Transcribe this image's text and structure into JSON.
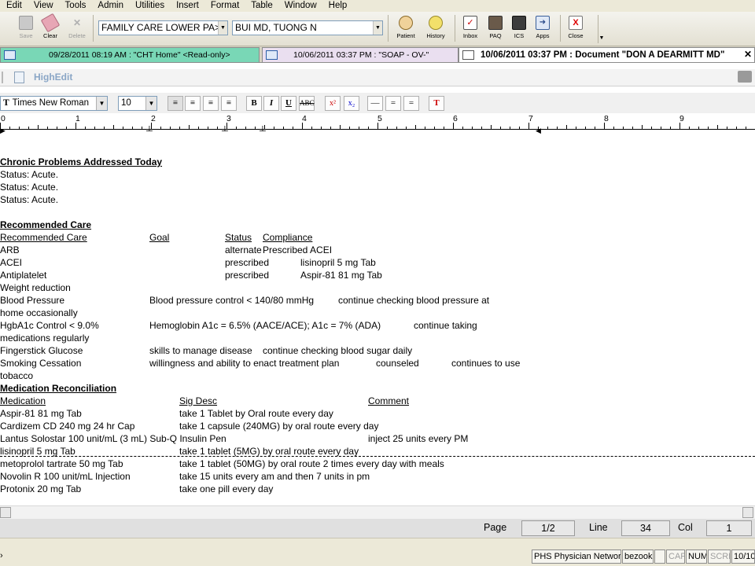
{
  "menu": [
    "Edit",
    "View",
    "Tools",
    "Admin",
    "Utilities",
    "Insert",
    "Format",
    "Table",
    "Window",
    "Help"
  ],
  "toolbar": {
    "save_label": "Save",
    "clear_label": "Clear",
    "delete_label": "Delete",
    "location_combo": "FAMILY CARE LOWER PA>",
    "provider_combo": "BUI MD, TUONG  N",
    "patient_label": "Patient",
    "history_label": "History",
    "inbox_label": "Inbox",
    "paq_label": "PAQ",
    "ics_label": "ICS",
    "apps_label": "Apps",
    "close_label": "Close"
  },
  "tabs": [
    {
      "label": "09/28/2011 08:19 AM : \"CHT Home\" <Read-only>"
    },
    {
      "label": "10/06/2011 03:37 PM : \"SOAP - OV-\""
    },
    {
      "label": "10/06/2011 03:37 PM  : Document \"DON A DEARMITT MD\""
    }
  ],
  "highedit": {
    "title": "HighEdit"
  },
  "format": {
    "font_name": "Times New Roman",
    "font_size": "10",
    "bold": "B",
    "italic": "I",
    "underline": "U",
    "strike": "ABC"
  },
  "ruler": {
    "numbers": [
      "0",
      "1",
      "2",
      "3",
      "4",
      "5",
      "6",
      "7",
      "8",
      "9"
    ]
  },
  "document": {
    "chronic_header": "Chronic Problems Addressed Today",
    "status_lines": [
      "Status: Acute.",
      "Status: Acute.",
      "Status: Acute."
    ],
    "rec_header": "Recommended Care",
    "rec_cols": {
      "care": "Recommended Care",
      "goal": "Goal",
      "status": "Status",
      "compliance": "Compliance"
    },
    "rec_rows": [
      {
        "care": "ARB",
        "goal": "",
        "status": "alternate",
        "compliance": "Prescribed ACEI"
      },
      {
        "care": "ACEI",
        "goal": "",
        "status": "prescribed",
        "compliance": "lisinopril 5 mg Tab"
      },
      {
        "care": "Antiplatelet",
        "goal": "",
        "status": "prescribed",
        "compliance": "Aspir-81 81 mg Tab"
      }
    ],
    "weight": "Weight reduction",
    "bp_care": "Blood Pressure",
    "bp_goal": "Blood pressure control < 140/80 mmHg",
    "bp_note": "continue checking  blood pressure at",
    "bp_wrap": "home occasionally",
    "a1c_care": "HgbA1c Control < 9.0%",
    "a1c_goal": "Hemoglobin A1c = 6.5% (AACE/ACE); A1c = 7%  (ADA)",
    "a1c_note": "continue taking",
    "a1c_wrap": "medications regularly",
    "fs_care": "Fingerstick Glucose",
    "fs_goal": "skills to manage disease",
    "fs_note": "continue checking blood sugar daily",
    "smk_care": "Smoking Cessation",
    "smk_goal": "willingness and ability to enact treatment plan",
    "smk_status": "counseled",
    "smk_note": "continues to use",
    "smk_wrap": "tobacco",
    "med_header": "Medication Reconciliation",
    "med_cols": {
      "med": "Medication",
      "sig": "Sig Desc",
      "comment": "Comment"
    },
    "meds": [
      {
        "med": "Aspir-81 81 mg Tab",
        "sig": "take 1 Tablet by Oral route  every day",
        "comment": ""
      },
      {
        "med": "Cardizem CD 240 mg 24 hr Cap",
        "sig": "take 1 capsule (240MG)  by oral route  every day",
        "comment": ""
      },
      {
        "med": "Lantus Solostar 100 unit/mL (3 mL) Sub-Q Insulin Pen",
        "sig": "",
        "comment": "inject 25 units every PM"
      },
      {
        "med": "lisinopril 5 mg Tab",
        "sig": "take 1 tablet (5MG)  by oral route  every day",
        "comment": ""
      },
      {
        "med": "metoprolol tartrate 50 mg Tab",
        "sig": "take 1 tablet (50MG)  by oral route 2 times every day with meals",
        "comment": ""
      },
      {
        "med": "Novolin R 100 unit/mL Injection",
        "sig": "take 15 units every am and then 7 units in pm",
        "comment": ""
      },
      {
        "med": "Protonix 20 mg Tab",
        "sig": "take one pill every day",
        "comment": ""
      }
    ]
  },
  "statusrow": {
    "page_label": "Page",
    "page_value": "1/2",
    "line_label": "Line",
    "line_value": "34",
    "col_label": "Col",
    "col_value": "1"
  },
  "bottombar": {
    "network": "PHS Physician Network",
    "user": "bezook",
    "cap": "CAP",
    "num": "NUM",
    "scrl": "SCRL",
    "date": "10/10"
  }
}
